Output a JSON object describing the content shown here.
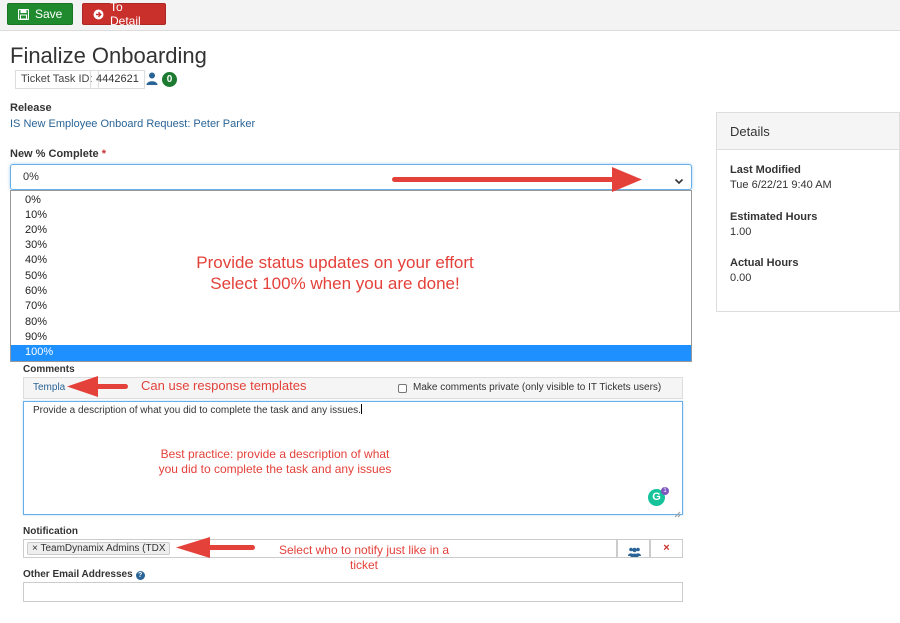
{
  "toolbar": {
    "save_label": "Save",
    "detail_label": "To Detail"
  },
  "page": {
    "title": "Finalize Onboarding",
    "ticket_task_id_label": "Ticket Task ID:",
    "ticket_task_id": "4442621",
    "assignee_count": "0"
  },
  "release": {
    "label": "Release",
    "link": "IS New Employee Onboard Request: Peter Parker"
  },
  "percent_complete": {
    "label": "New % Complete",
    "required_mark": "*",
    "selected_value": "0%",
    "options": [
      "0%",
      "10%",
      "20%",
      "30%",
      "40%",
      "50%",
      "60%",
      "70%",
      "80%",
      "90%",
      "100%"
    ],
    "highlighted_option": "100%"
  },
  "details": {
    "header": "Details",
    "last_modified_label": "Last Modified",
    "last_modified": "Tue 6/22/21 9:40 AM",
    "estimated_hours_label": "Estimated Hours",
    "estimated_hours": "1.00",
    "actual_hours_label": "Actual Hours",
    "actual_hours": "0.00"
  },
  "comments": {
    "label": "Comments",
    "templates_label": "Templa",
    "private_label": "Make comments private (only visible to IT Tickets users)",
    "text": "Provide a description of what you did to complete the task and any issues."
  },
  "notification": {
    "label": "Notification",
    "token": "TeamDynamix Admins (TDX"
  },
  "other_email": {
    "label": "Other Email Addresses"
  },
  "annotations": {
    "status_line1": "Provide status updates on your effort",
    "status_line2": "Select 100% when you are done!",
    "templates": "Can use response templates",
    "best_line1": "Best practice: provide a description of what",
    "best_line2": "you did to complete the task and any issues",
    "notify_line1": "Select who to notify just like in a",
    "notify_line2": "ticket"
  },
  "colors": {
    "save_button": "#1f8a2e",
    "detail_button": "#c9302c",
    "link": "#2a6496",
    "selected_option": "#1e90ff",
    "annotation": "#e4413a"
  },
  "icons": [
    "save-icon",
    "arrow-circle-icon",
    "person-icon",
    "chevron-down-icon",
    "help-icon",
    "group-icon",
    "remove-icon",
    "grammarly-icon"
  ]
}
